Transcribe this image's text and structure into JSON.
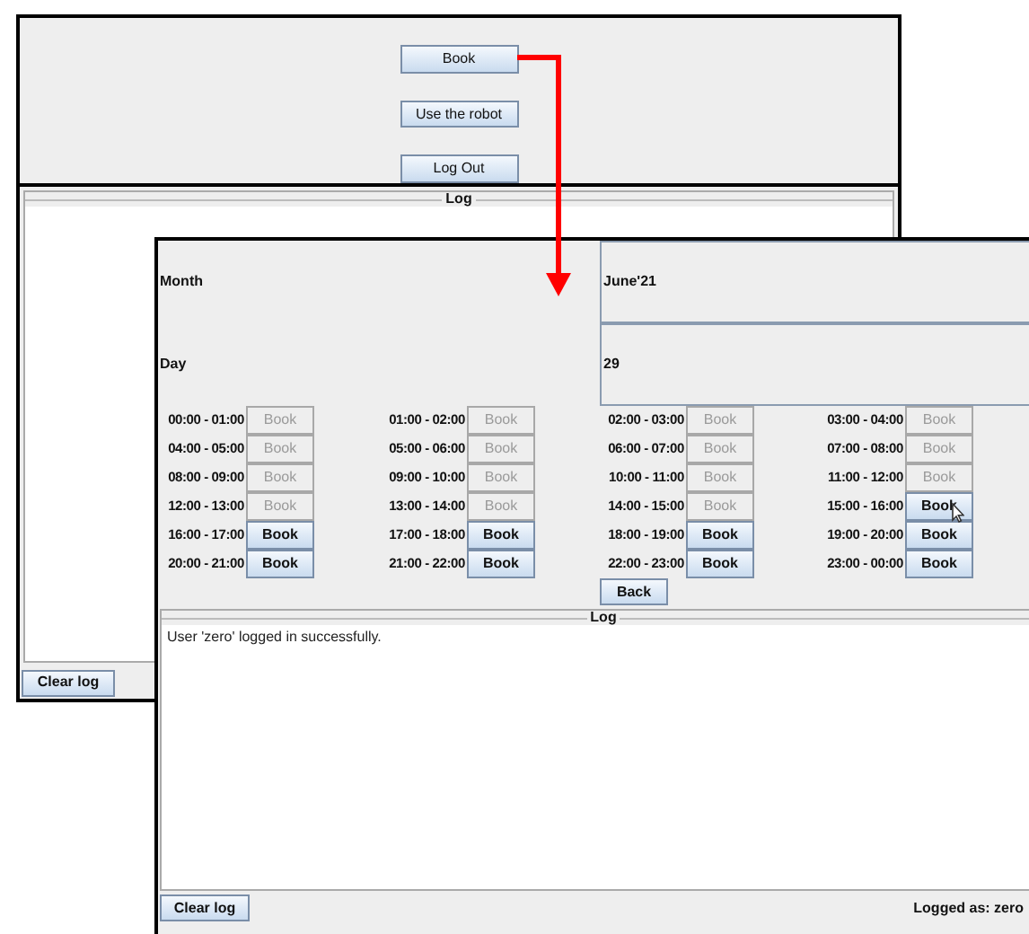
{
  "back_window": {
    "buttons": [
      "Book",
      "Use the robot",
      "Log Out"
    ],
    "log": {
      "title": "Log"
    },
    "clear_button": "Clear log"
  },
  "front_window": {
    "month": {
      "label": "Month",
      "value": "June'21"
    },
    "day": {
      "label": "Day",
      "value": "29"
    },
    "slots": [
      {
        "time": "00:00 - 01:00",
        "button": "Book",
        "disabled": true
      },
      {
        "time": "01:00 - 02:00",
        "button": "Book",
        "disabled": true
      },
      {
        "time": "02:00 - 03:00",
        "button": "Book",
        "disabled": true
      },
      {
        "time": "03:00 - 04:00",
        "button": "Book",
        "disabled": true
      },
      {
        "time": "04:00 - 05:00",
        "button": "Book",
        "disabled": true
      },
      {
        "time": "05:00 - 06:00",
        "button": "Book",
        "disabled": true
      },
      {
        "time": "06:00 - 07:00",
        "button": "Book",
        "disabled": true
      },
      {
        "time": "07:00 - 08:00",
        "button": "Book",
        "disabled": true
      },
      {
        "time": "08:00 - 09:00",
        "button": "Book",
        "disabled": true
      },
      {
        "time": "09:00 - 10:00",
        "button": "Book",
        "disabled": true
      },
      {
        "time": "10:00 - 11:00",
        "button": "Book",
        "disabled": true
      },
      {
        "time": "11:00 - 12:00",
        "button": "Book",
        "disabled": true
      },
      {
        "time": "12:00 - 13:00",
        "button": "Book",
        "disabled": true
      },
      {
        "time": "13:00 - 14:00",
        "button": "Book",
        "disabled": true
      },
      {
        "time": "14:00 - 15:00",
        "button": "Book",
        "disabled": true
      },
      {
        "time": "15:00 - 16:00",
        "button": "Book",
        "disabled": false
      },
      {
        "time": "16:00 - 17:00",
        "button": "Book",
        "disabled": false
      },
      {
        "time": "17:00 - 18:00",
        "button": "Book",
        "disabled": false
      },
      {
        "time": "18:00 - 19:00",
        "button": "Book",
        "disabled": false
      },
      {
        "time": "19:00 - 20:00",
        "button": "Book",
        "disabled": false
      },
      {
        "time": "20:00 - 21:00",
        "button": "Book",
        "disabled": false
      },
      {
        "time": "21:00 - 22:00",
        "button": "Book",
        "disabled": false
      },
      {
        "time": "22:00 - 23:00",
        "button": "Book",
        "disabled": false
      },
      {
        "time": "23:00 - 00:00",
        "button": "Book",
        "disabled": false
      }
    ],
    "back_button": "Back",
    "log": {
      "title": "Log",
      "lines": [
        "User 'zero' logged in successfully."
      ]
    },
    "clear_button": "Clear log",
    "status": "Logged as: zero"
  }
}
